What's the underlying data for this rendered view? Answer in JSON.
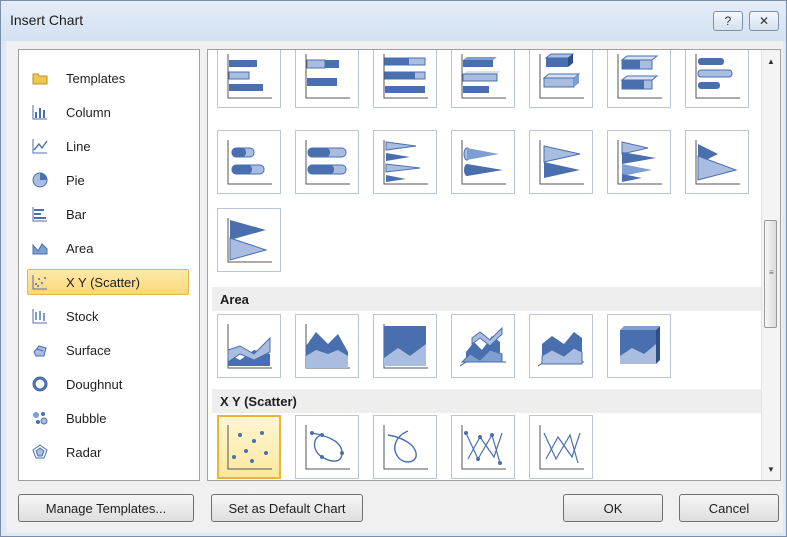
{
  "window": {
    "title": "Insert Chart",
    "help_glyph": "?",
    "close_glyph": "✕"
  },
  "categories": [
    {
      "label": "Templates",
      "icon": "folder-icon"
    },
    {
      "label": "Column",
      "icon": "column-chart-icon"
    },
    {
      "label": "Line",
      "icon": "line-chart-icon"
    },
    {
      "label": "Pie",
      "icon": "pie-chart-icon"
    },
    {
      "label": "Bar",
      "icon": "bar-chart-icon"
    },
    {
      "label": "Area",
      "icon": "area-chart-icon"
    },
    {
      "label": "X Y (Scatter)",
      "icon": "scatter-chart-icon",
      "selected": true
    },
    {
      "label": "Stock",
      "icon": "stock-chart-icon"
    },
    {
      "label": "Surface",
      "icon": "surface-chart-icon"
    },
    {
      "label": "Doughnut",
      "icon": "doughnut-chart-icon"
    },
    {
      "label": "Bubble",
      "icon": "bubble-chart-icon"
    },
    {
      "label": "Radar",
      "icon": "radar-chart-icon"
    }
  ],
  "gallery": {
    "sections": [
      {
        "title": "Area"
      },
      {
        "title": "X Y (Scatter)"
      }
    ]
  },
  "buttons": {
    "manage_templates": "Manage Templates...",
    "set_default": "Set as Default Chart",
    "ok": "OK",
    "cancel": "Cancel"
  },
  "colors": {
    "selection_fill": "#fbd878",
    "selection_border": "#e2b84b",
    "chart_blue": "#4a6fae",
    "chart_light_blue": "#a9bde0"
  }
}
